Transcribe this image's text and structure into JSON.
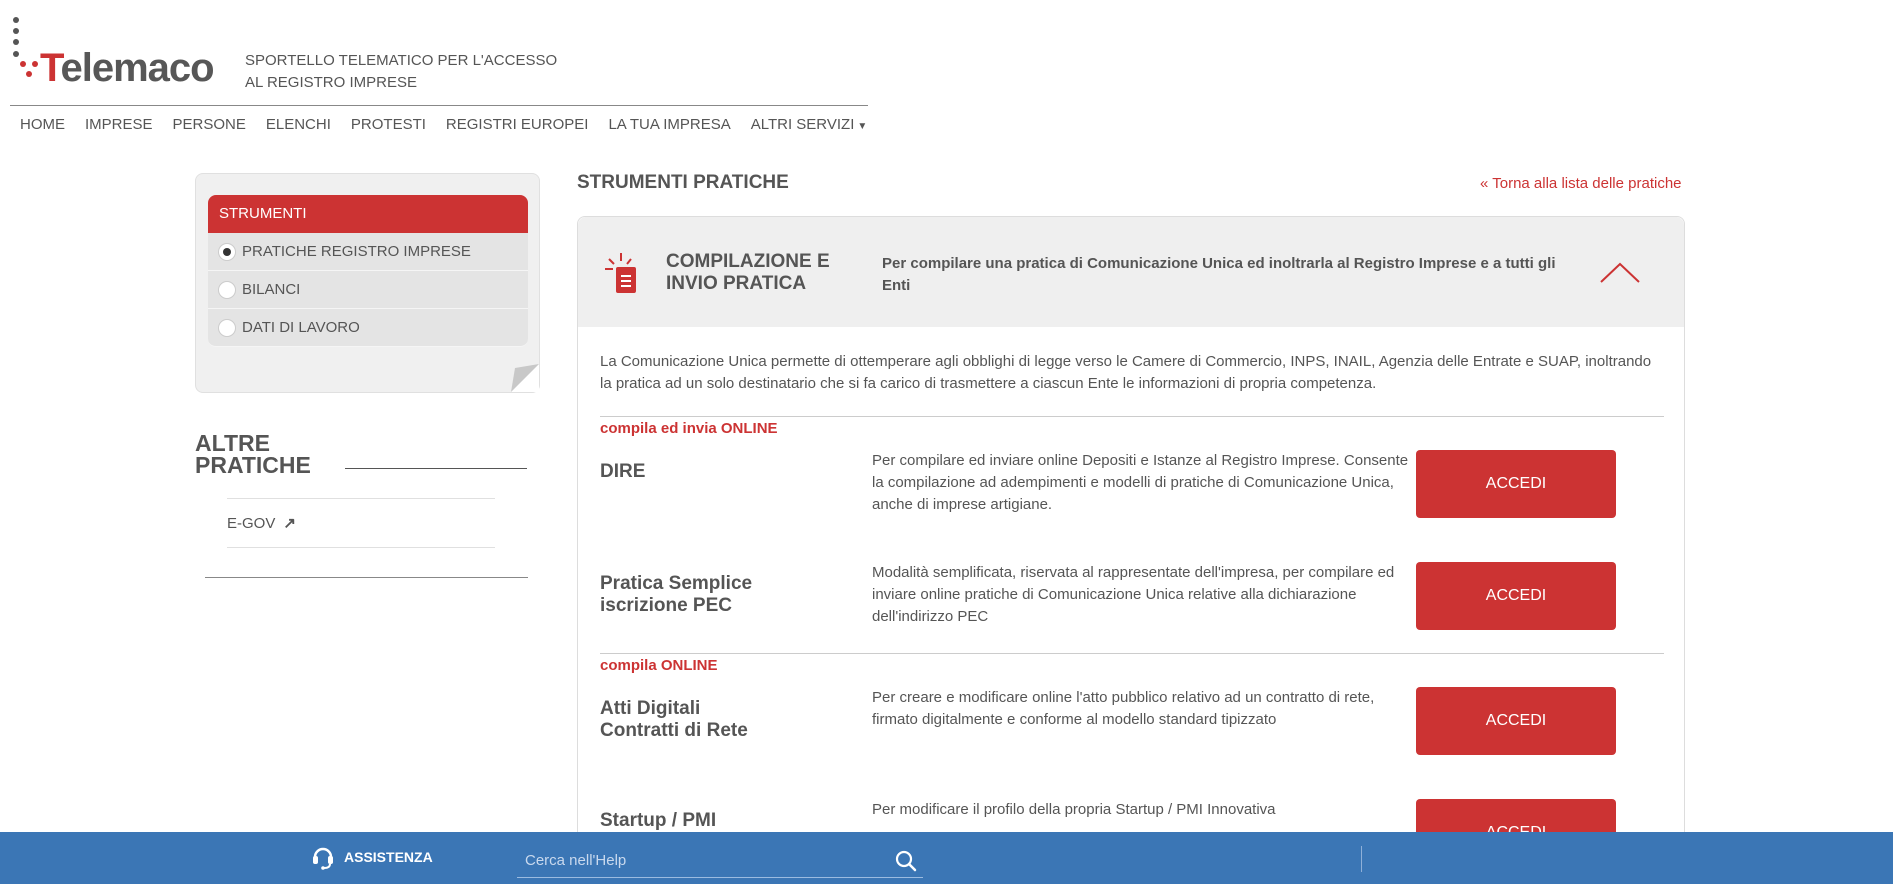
{
  "header": {
    "logo_text_t": "T",
    "logo_text_rest": "elemaco",
    "tagline_line1": "SPORTELLO TELEMATICO PER L'ACCESSO",
    "tagline_line2": "AL REGISTRO IMPRESE"
  },
  "nav": {
    "items": [
      "HOME",
      "IMPRESE",
      "PERSONE",
      "ELENCHI",
      "PROTESTI",
      "REGISTRI EUROPEI",
      "LA TUA IMPRESA",
      "ALTRI SERVIZI"
    ]
  },
  "sidebar": {
    "header": "STRUMENTI",
    "options": [
      "PRATICHE REGISTRO IMPRESE",
      "BILANCI",
      "DATI DI LAVORO"
    ],
    "selected_index": 0,
    "altre_title_line1": "ALTRE",
    "altre_title_line2": "PRATICHE",
    "altre_items": [
      "E-GOV"
    ]
  },
  "main": {
    "title": "STRUMENTI PRATICHE",
    "back_link": "« Torna alla lista delle pratiche",
    "panel": {
      "title_line1": "COMPILAZIONE E",
      "title_line2": "INVIO PRATICA",
      "description": "Per compilare una pratica di Comunicazione Unica ed inoltrarla al Registro Imprese e a tutti gli Enti",
      "intro": "La Comunicazione Unica permette di ottemperare agli obblighi di legge verso le Camere di Commercio, INPS, INAIL, Agenzia delle Entrate e SUAP, inoltrando la pratica ad un solo destinatario che si fa carico di trasmettere a ciascun Ente le informazioni di propria competenza.",
      "group1_label": "compila ed invia ONLINE",
      "group2_label": "compila ONLINE",
      "services": [
        {
          "name_line1": "DIRE",
          "name_line2": "",
          "description": "Per compilare ed inviare online Depositi e Istanze al Registro Imprese. Consente la compilazione ad adempimenti e modelli di pratiche di Comunicazione Unica, anche di imprese artigiane.",
          "button": "ACCEDI"
        },
        {
          "name_line1": "Pratica Semplice",
          "name_line2": "iscrizione PEC",
          "description": "Modalità semplificata, riservata al rappresentate dell'impresa, per compilare ed inviare online pratiche di Comunicazione Unica relative alla dichiarazione dell'indirizzo PEC",
          "button": "ACCEDI"
        },
        {
          "name_line1": "Atti Digitali",
          "name_line2": "Contratti di Rete",
          "description": "Per creare e modificare online l'atto pubblico relativo ad un contratto di rete, firmato digitalmente e conforme al modello standard tipizzato",
          "button": "ACCEDI"
        },
        {
          "name_line1": "Startup / PMI",
          "name_line2": "",
          "description": "Per modificare il profilo della propria Startup / PMI Innovativa",
          "button": "ACCEDI"
        }
      ]
    }
  },
  "footer": {
    "assist_label": "ASSISTENZA",
    "search_placeholder": "Cerca nell'Help"
  },
  "colors": {
    "brand_red": "#cc3333",
    "footer_blue": "#3b76b5"
  }
}
